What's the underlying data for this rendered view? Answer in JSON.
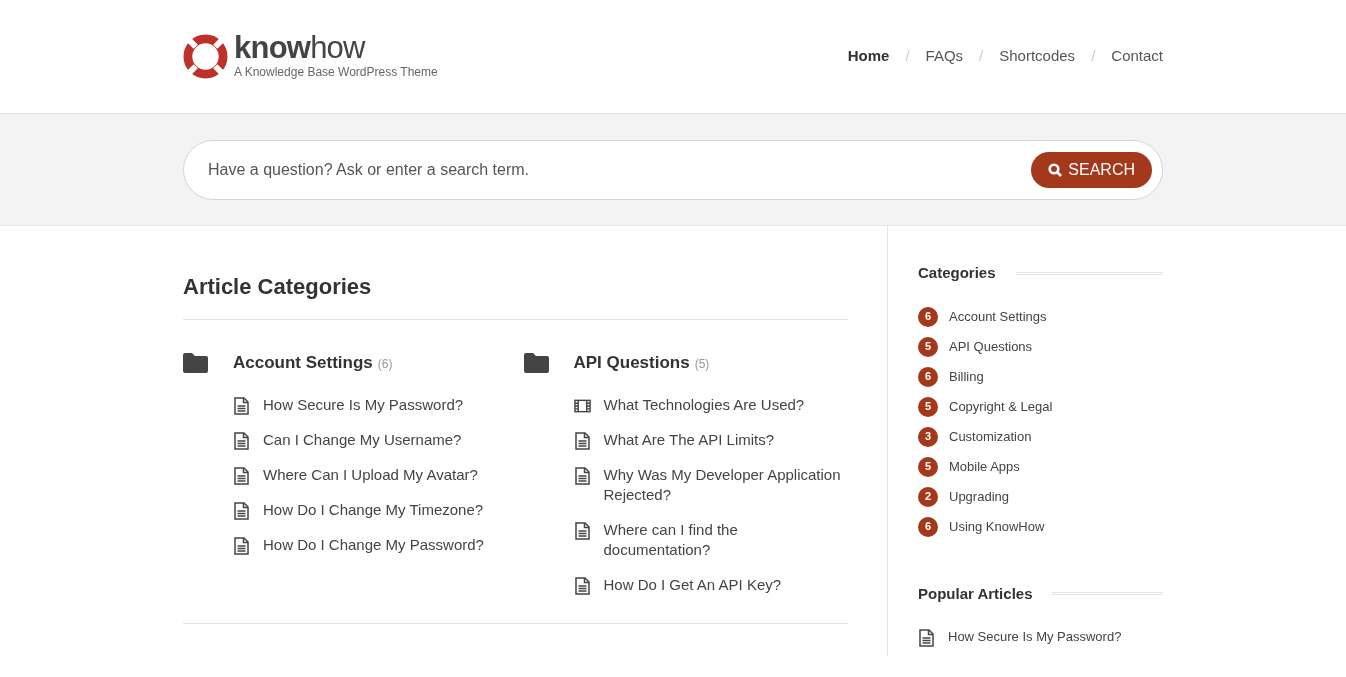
{
  "logo": {
    "name": "**know**how",
    "tagline": "A Knowledge Base WordPress Theme"
  },
  "nav": [
    {
      "label": "Home",
      "selected": true
    },
    {
      "label": "FAQs",
      "selected": false
    },
    {
      "label": "Shortcodes",
      "selected": false
    },
    {
      "label": "Contact",
      "selected": false
    }
  ],
  "nav_separator": "/",
  "search": {
    "placeholder": "Have a question? Ask or enter a search term.",
    "button": "SEARCH"
  },
  "main": {
    "title": "Article Categories",
    "categories": [
      {
        "name": "Account Settings",
        "count": "(6)",
        "articles": [
          {
            "kind": "document",
            "title": "How Secure Is My Password?"
          },
          {
            "kind": "document",
            "title": "Can I Change My Username?"
          },
          {
            "kind": "document",
            "title": "Where Can I Upload My Avatar?"
          },
          {
            "kind": "document",
            "title": "How Do I Change My Timezone?"
          },
          {
            "kind": "document",
            "title": "How Do I Change My Password?"
          }
        ]
      },
      {
        "name": "API Questions",
        "count": "(5)",
        "articles": [
          {
            "kind": "video",
            "title": "What Technologies Are Used?"
          },
          {
            "kind": "document",
            "title": "What Are The API Limits?"
          },
          {
            "kind": "document",
            "title": "Why Was My Developer Application Rejected?"
          },
          {
            "kind": "document",
            "title": "Where can I find the documentation?"
          },
          {
            "kind": "document",
            "title": "How Do I Get An API Key?"
          }
        ]
      }
    ]
  },
  "sidebar": {
    "categories_title": "Categories",
    "categories": [
      {
        "count": "6",
        "name": "Account Settings"
      },
      {
        "count": "5",
        "name": "API Questions"
      },
      {
        "count": "6",
        "name": "Billing"
      },
      {
        "count": "5",
        "name": "Copyright & Legal"
      },
      {
        "count": "3",
        "name": "Customization"
      },
      {
        "count": "5",
        "name": "Mobile Apps"
      },
      {
        "count": "2",
        "name": "Upgrading"
      },
      {
        "count": "6",
        "name": "Using KnowHow"
      }
    ],
    "popular_title": "Popular Articles",
    "popular": [
      {
        "kind": "document",
        "title": "How Secure Is My Password?"
      }
    ]
  }
}
